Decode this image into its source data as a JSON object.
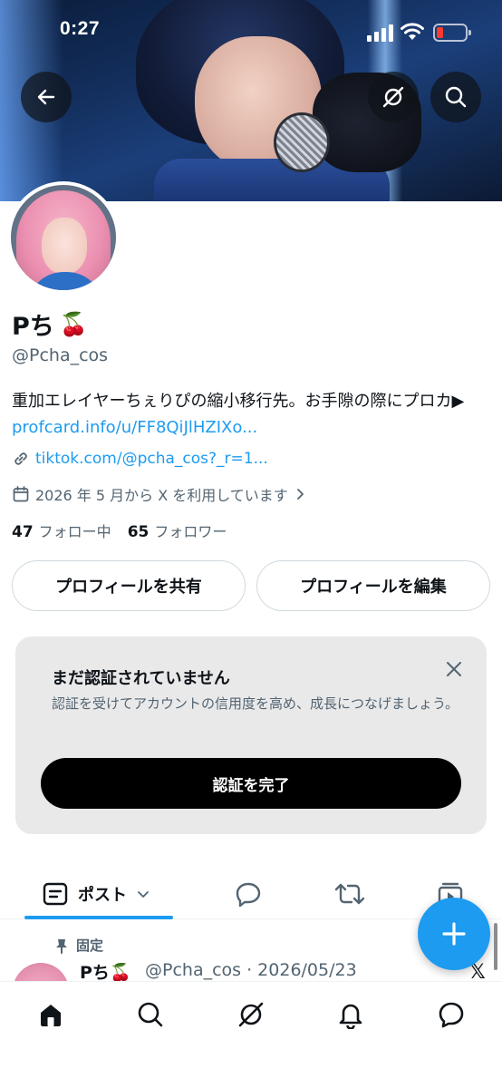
{
  "status_bar": {
    "time": "0:27"
  },
  "profile": {
    "display_name": "Pち",
    "name_emoji": "🍒",
    "handle": "@Pcha_cos",
    "bio_text": "重加エレイヤーちぇりぴの縮小移行先。お手隙の際にプロカ▶ ",
    "bio_link": "profcard.info/u/FF8QiJlHZIXo...",
    "website": "tiktok.com/@pcha_cos?_r=1...",
    "joined": "2026 年 5 月から X を利用しています",
    "following_count": "47",
    "following_label": "フォロー中",
    "followers_count": "65",
    "followers_label": "フォロワー"
  },
  "buttons": {
    "share_profile": "プロフィールを共有",
    "edit_profile": "プロフィールを編集"
  },
  "verify_card": {
    "title": "まだ認証されていません",
    "description": "認証を受けてアカウントの信用度を高め、成長につなげましょう。",
    "button": "認証を完了"
  },
  "tabs": {
    "posts_label": "ポスト"
  },
  "pinned_post": {
    "pinned_label": "固定",
    "author_name": "Pち",
    "author_emoji": "🍒",
    "author_handle_date": "@Pcha_cos · 2026/05/23",
    "source_mark": "𝕏"
  },
  "colors": {
    "accent": "#1d9bf0",
    "text": "#0f1419",
    "muted": "#536471",
    "battery_low": "#ff3b30"
  }
}
